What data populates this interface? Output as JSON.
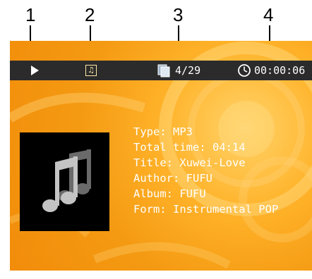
{
  "callouts": [
    "1",
    "2",
    "3",
    "4"
  ],
  "statusbar": {
    "play_icon": "play-icon",
    "music_icon": "music-note-icon",
    "track_position": "4/29",
    "elapsed_time": "00:00:06"
  },
  "track_info": {
    "type": "Type: MP3",
    "total_time": "Total time: 04:14",
    "title": "Title: Xuwei-Love",
    "author": "Author: FUFU",
    "album": "Album: FUFU",
    "form": "Form: Instrumental POP"
  },
  "colors": {
    "background_orange": "#f49a12",
    "statusbar": "#2b2b2b",
    "text": "#ffffff"
  }
}
